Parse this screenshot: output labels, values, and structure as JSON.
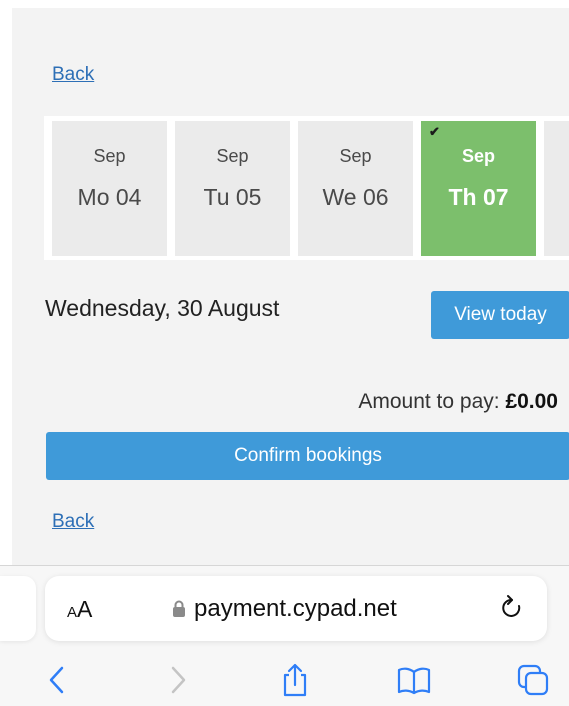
{
  "page": {
    "back_top": "Back",
    "back_bottom": "Back"
  },
  "days": [
    {
      "month": "Sep",
      "date": "Mo 04",
      "selected": false
    },
    {
      "month": "Sep",
      "date": "Tu 05",
      "selected": false
    },
    {
      "month": "Sep",
      "date": "We 06",
      "selected": false
    },
    {
      "month": "Sep",
      "date": "Th 07",
      "selected": true
    }
  ],
  "date_section": {
    "current_date": "Wednesday, 30 August",
    "view_today_label": "View today"
  },
  "payment": {
    "amount_label": "Amount to pay:",
    "amount_value": "£0.00",
    "confirm_label": "Confirm bookings"
  },
  "browser": {
    "text_size_small": "A",
    "text_size_large": "A",
    "url": "payment.cypad.net",
    "icons": [
      "lock-icon",
      "reload-icon",
      "back-icon",
      "forward-icon",
      "share-icon",
      "bookmarks-icon",
      "tabs-icon"
    ]
  },
  "colors": {
    "accent_blue": "#3f9ad9",
    "selected_green": "#7cbf6c",
    "link_blue": "#2d6fb6"
  }
}
